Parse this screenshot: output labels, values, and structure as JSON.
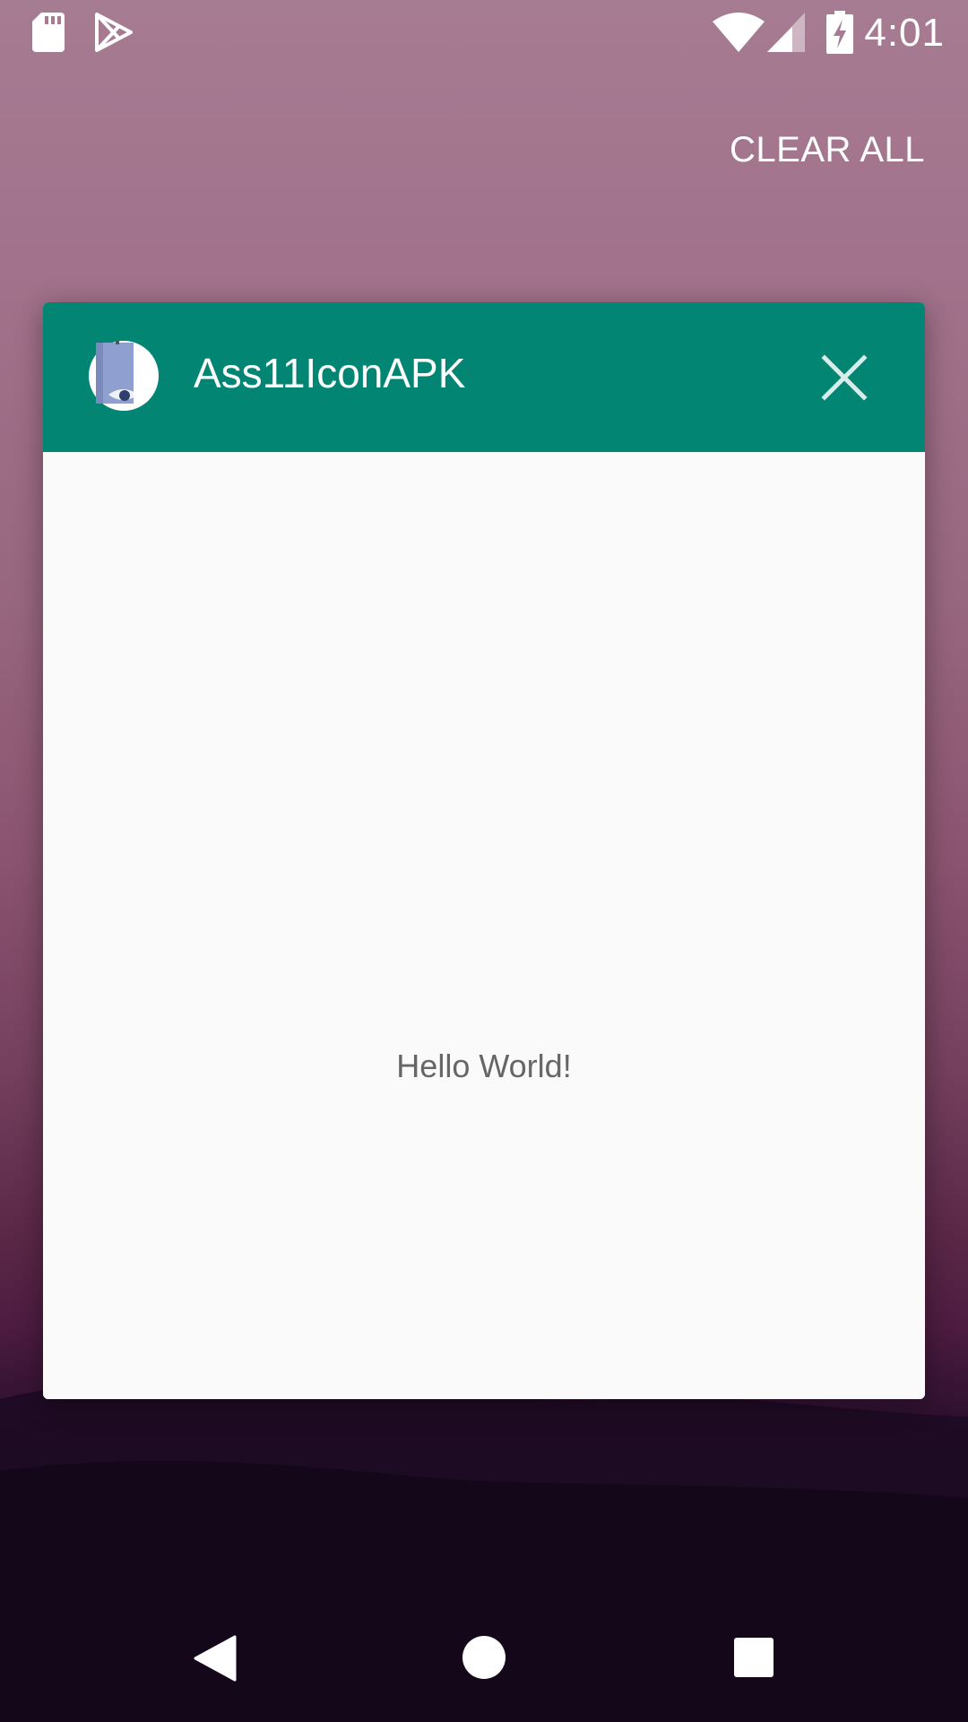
{
  "status_bar": {
    "time": "4:01",
    "icons": [
      "sd-card-icon",
      "play-store-icon",
      "wifi-icon",
      "cell-signal-icon",
      "battery-charging-icon"
    ]
  },
  "recents": {
    "clear_all_label": "CLEAR ALL",
    "card": {
      "app_name": "Ass11IconAPK",
      "header_color": "#038574",
      "content_text": "Hello World!"
    }
  },
  "nav_bar": {
    "buttons": [
      "back-icon",
      "home-icon",
      "recents-icon"
    ]
  }
}
